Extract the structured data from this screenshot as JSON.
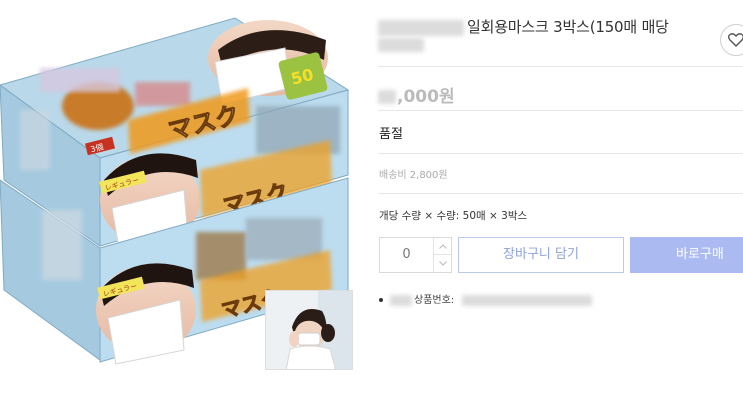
{
  "product": {
    "title": "일회용마스크 3박스(150매 매당",
    "price_suffix": ",000원",
    "status": "품절",
    "shipping": "배송비 2,800원",
    "option": "개당 수량 × 수량: 50매 × 3박스",
    "quantity": "0",
    "code_label": "상품번호:",
    "box_text": {
      "mask_katakana": "マスク",
      "regular_label": "レギュラー",
      "count_badge": "50",
      "box_count": "3個"
    }
  },
  "actions": {
    "cart_label": "장바구니 담기",
    "buy_label": "바로구매"
  },
  "icons": {
    "favorite": "heart-icon",
    "qty_up": "chevron-up-icon",
    "qty_down": "chevron-down-icon"
  },
  "colors": {
    "buy_button": "#abbaf0",
    "cart_text": "#8fa3da",
    "box_blue": "#9fc6de",
    "mask_orange": "#f0a020",
    "badge_green": "#a6c84a"
  }
}
